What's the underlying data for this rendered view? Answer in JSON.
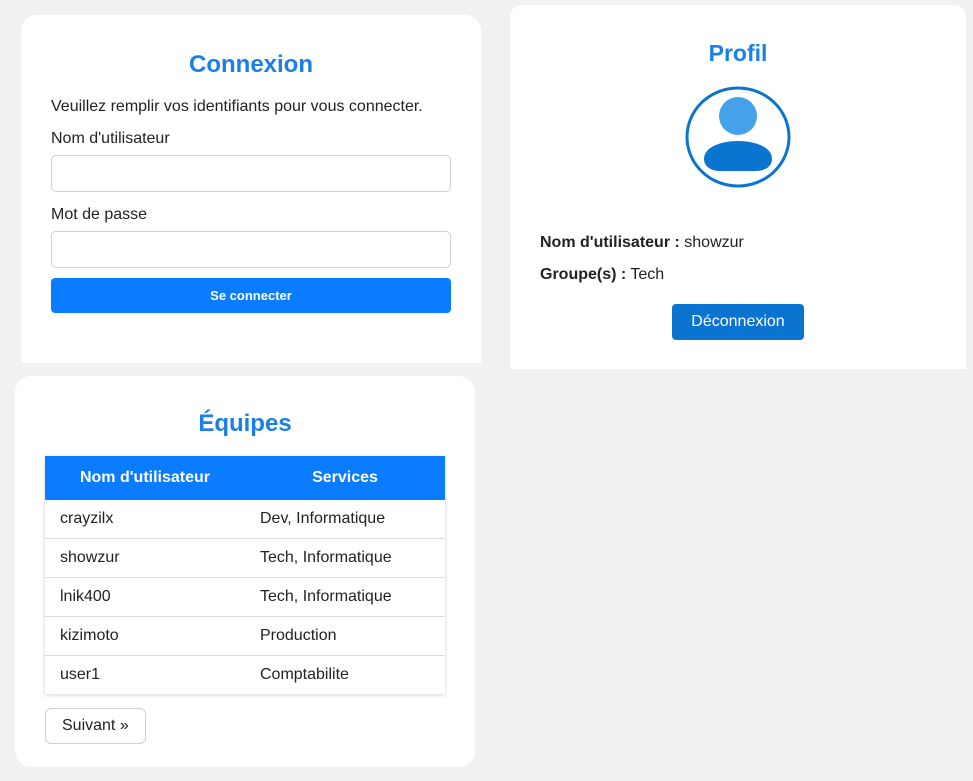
{
  "login": {
    "title": "Connexion",
    "intro": "Veuillez remplir vos identifiants pour vous connecter.",
    "username_label": "Nom d'utilisateur",
    "username_value": "",
    "password_label": "Mot de passe",
    "password_value": "",
    "submit_label": "Se connecter"
  },
  "profile": {
    "title": "Profil",
    "avatar_icon": "user-avatar-icon",
    "username_label": "Nom d'utilisateur :",
    "username_value": "showzur",
    "group_label": "Groupe(s) :",
    "group_value": "Tech",
    "logout_label": "Déconnexion"
  },
  "teams": {
    "title": "Équipes",
    "columns": [
      "Nom d'utilisateur",
      "Services"
    ],
    "rows": [
      {
        "user": "crayzilx",
        "services": "Dev, Informatique"
      },
      {
        "user": "showzur",
        "services": "Tech, Informatique"
      },
      {
        "user": "lnik400",
        "services": "Tech, Informatique"
      },
      {
        "user": "kizimoto",
        "services": "Production"
      },
      {
        "user": "user1",
        "services": "Comptabilite"
      }
    ],
    "next_label": "Suivant »"
  },
  "colors": {
    "accent": "#1a7fe8",
    "primary_button": "#0a7cff",
    "logout_button": "#0b74d1",
    "background": "#f1f1f1"
  }
}
